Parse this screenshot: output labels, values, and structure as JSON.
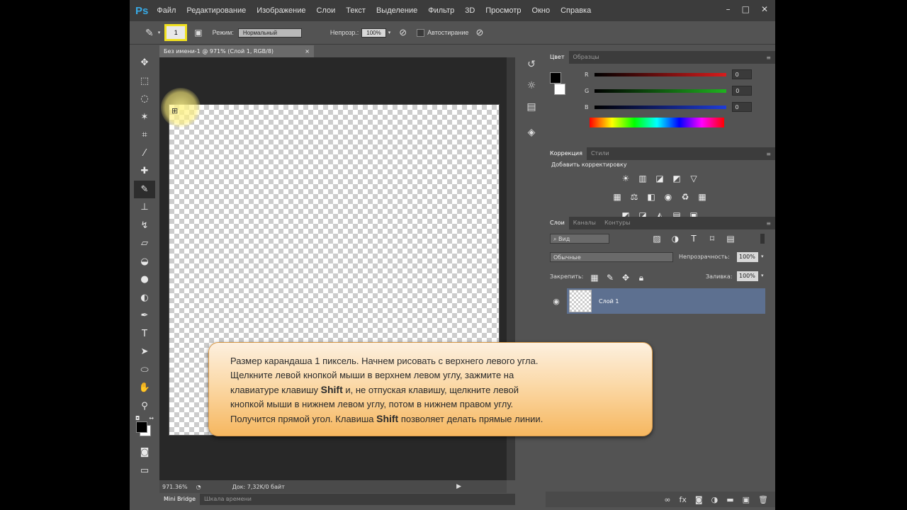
{
  "menubar": {
    "logo": "Ps",
    "items": [
      "Файл",
      "Редактирование",
      "Изображение",
      "Слои",
      "Текст",
      "Выделение",
      "Фильтр",
      "3D",
      "Просмотр",
      "Окно",
      "Справка"
    ],
    "min": "–",
    "max": "□",
    "close": "✕"
  },
  "options": {
    "brush_size": "1",
    "mode_label": "Режим:",
    "mode_value": "Нормальный",
    "opacity_label": "Непрозр.:",
    "opacity_value": "100%",
    "auto_erase_label": "Автостирание"
  },
  "document": {
    "tab_title": "Без имени-1 @ 971% (Слой 1, RGB/8)",
    "tab_close": "×",
    "zoom": "971.36%",
    "doc_info": "Док: 7,32K/0 байт"
  },
  "bottom_tabs": [
    "Mini Bridge",
    "Шкала времени"
  ],
  "color_panel": {
    "tabs": [
      "Цвет",
      "Образцы"
    ],
    "r_label": "R",
    "g_label": "G",
    "b_label": "B",
    "r": "0",
    "g": "0",
    "b": "0",
    "colors": {
      "red": "#d81c1c",
      "green": "#1fb31f",
      "blue": "#1f3cd8"
    }
  },
  "adjust_panel": {
    "tabs": [
      "Коррекция",
      "Стили"
    ],
    "title": "Добавить корректировку"
  },
  "layers_panel": {
    "tabs": [
      "Слои",
      "Каналы",
      "Контуры"
    ],
    "filter": "Вид",
    "blend": "Обычные",
    "opacity_label": "Непрозрачность:",
    "opacity": "100%",
    "lock_label": "Закрепить:",
    "fill_label": "Заливка:",
    "fill": "100%",
    "layer_name": "Слой 1",
    "bottom_icons": [
      "link-icon",
      "fx-icon",
      "mask-icon",
      "adjustment-icon",
      "folder-icon",
      "new-layer-icon",
      "trash-icon"
    ]
  },
  "callout": {
    "l1": "Размер карандаша 1 пиксель. Начнем рисовать с верхнего левого угла.",
    "l2": "Щелкните левой кнопкой мыши в верхнем левом углу, зажмите на",
    "l3a": "клавиатуре клавишу ",
    "l3b": "Shift",
    "l3c": " и, не отпуская клавишу, щелкните левой",
    "l4": "кнопкой мыши в нижнем левом углу, потом в нижнем правом углу.",
    "l5a": "Получится прямой угол. Клавиша ",
    "l5b": "Shift",
    "l5c": " позволяет делать прямые линии."
  }
}
